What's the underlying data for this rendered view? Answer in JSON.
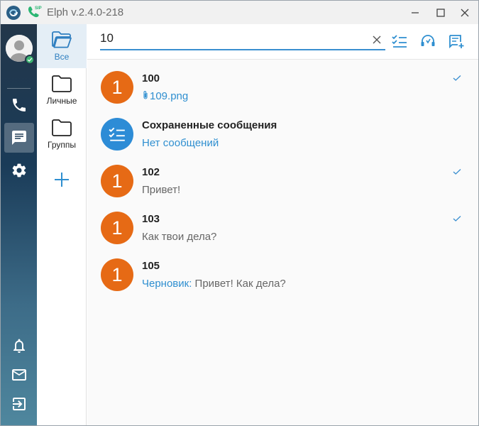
{
  "window": {
    "title": "Elph v.2.4.0-218"
  },
  "folders": [
    {
      "label": "Все",
      "active": true
    },
    {
      "label": "Личные",
      "active": false
    },
    {
      "label": "Группы",
      "active": false
    }
  ],
  "search": {
    "value": "10"
  },
  "chats": [
    {
      "avatar": "1",
      "name": "100",
      "preview": "109.png",
      "attachment": true,
      "read": true
    },
    {
      "avatar": "",
      "name": "Сохраненные сообщения",
      "preview": "Нет сообщений",
      "saved": true,
      "read": false
    },
    {
      "avatar": "1",
      "name": "102",
      "preview": "Привет!",
      "read": true
    },
    {
      "avatar": "1",
      "name": "103",
      "preview": "Как твои дела?",
      "read": true
    },
    {
      "avatar": "1",
      "name": "105",
      "draft_label": "Черновик:",
      "preview": " Привет! Как дела?",
      "read": false
    }
  ],
  "colors": {
    "accent": "#3a8fd0",
    "avatar_orange": "#e66a15",
    "avatar_blue": "#2d8cd6",
    "online": "#3cb371"
  },
  "icons": [
    "app-logo-icon",
    "sip-phone-icon",
    "minimize-icon",
    "maximize-icon",
    "close-icon",
    "phone-icon",
    "chat-icon",
    "gear-icon",
    "bell-icon",
    "mail-icon",
    "logout-icon",
    "folder-open-icon",
    "folder-icon",
    "plus-icon",
    "clear-icon",
    "select-list-icon",
    "support-icon",
    "new-chat-icon",
    "checkmark-icon",
    "paperclip-icon"
  ]
}
